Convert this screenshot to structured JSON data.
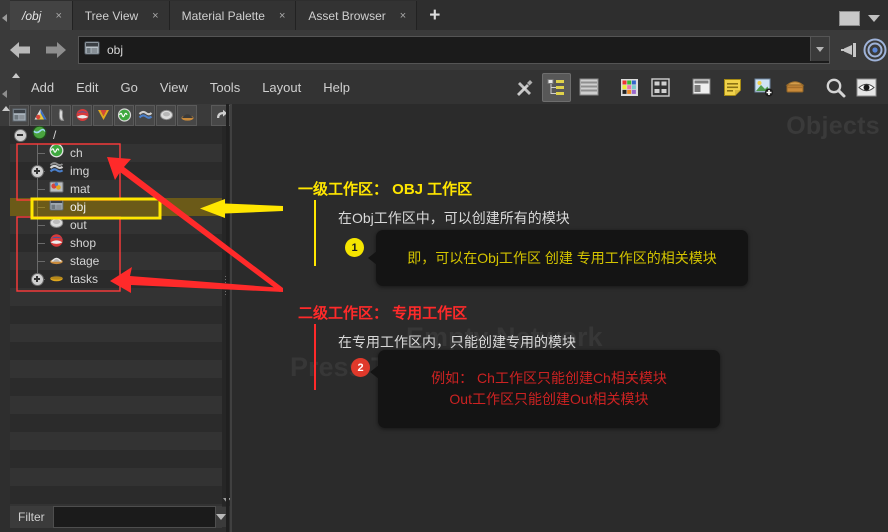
{
  "window": {
    "tabs": [
      {
        "label": "/obj",
        "active": true,
        "close": "×"
      },
      {
        "label": "Tree View",
        "active": false,
        "close": "×"
      },
      {
        "label": "Material Palette",
        "active": false,
        "close": "×"
      },
      {
        "label": "Asset Browser",
        "active": false,
        "close": "×"
      }
    ],
    "add_tab_label": "+",
    "maximize_label": "",
    "menu_caret_label": ""
  },
  "pathbar": {
    "value": "obj",
    "dropdown_label": "",
    "back_label": "",
    "forward_label": ""
  },
  "menubar": {
    "items": [
      "Add",
      "Edit",
      "Go",
      "View",
      "Tools",
      "Layout",
      "Help"
    ],
    "icons": [
      "wrench-screwdriver-icon",
      "tree-view-icon",
      "list-view-icon",
      "color-palette-icon",
      "thumbnail-grid-icon",
      "layout-panes-icon",
      "notes-icon",
      "add-image-icon",
      "package-box-icon",
      "magnifier-icon",
      "eye-icon"
    ]
  },
  "tree_panel": {
    "toolbar_icons": [
      "obj-node-icon",
      "cop-node-icon",
      "bone-node-icon",
      "shop-node-icon",
      "vop-node-icon",
      "chop-node-icon",
      "dop-node-icon",
      "out-node-icon",
      "stage-node-icon",
      "undo-icon"
    ],
    "root_label": "/",
    "nodes": [
      {
        "label": "ch",
        "expandable": false,
        "selected": false,
        "icon": "chop-network-icon"
      },
      {
        "label": "img",
        "expandable": true,
        "selected": false,
        "icon": "cop-network-icon"
      },
      {
        "label": "mat",
        "expandable": false,
        "selected": false,
        "icon": "mat-network-icon"
      },
      {
        "label": "obj",
        "expandable": false,
        "selected": true,
        "icon": "obj-network-icon"
      },
      {
        "label": "out",
        "expandable": false,
        "selected": false,
        "icon": "out-network-icon"
      },
      {
        "label": "shop",
        "expandable": false,
        "selected": false,
        "icon": "shop-network-icon"
      },
      {
        "label": "stage",
        "expandable": false,
        "selected": false,
        "icon": "stage-network-icon"
      },
      {
        "label": "tasks",
        "expandable": true,
        "selected": false,
        "icon": "tasks-network-icon"
      }
    ],
    "filter_label": "Filter",
    "filter_value": "",
    "filter_placeholder": ""
  },
  "network_pane": {
    "corner_label": "Objects",
    "watermark_line1": "Empty Network",
    "watermark_line2": "Press Tab to Add Objects"
  },
  "annotations": {
    "colors": {
      "yellow": "#ffe600",
      "red": "#ff2a2a",
      "white": "#d9d9d9",
      "callout_bg": "#141414"
    },
    "section1": {
      "heading": "一级工作区： OBJ 工作区",
      "heading_color": "#ffe600",
      "subtext": "在Obj工作区中，可以创建所有的模块",
      "badge": "1",
      "callout": "即，可以在Obj工作区 创建 专用工作区的相关模块",
      "callout_color": "#d4c400"
    },
    "section2": {
      "heading": "二级工作区： 专用工作区",
      "heading_color": "#ff2a2a",
      "subtext": "在专用工作区内，只能创建专用的模块",
      "badge": "2",
      "callout_line1": "例如： Ch工作区只能创建Ch相关模块",
      "callout_line2": "Out工作区只能创建Out相关模块",
      "callout_color": "#cc2222"
    }
  }
}
